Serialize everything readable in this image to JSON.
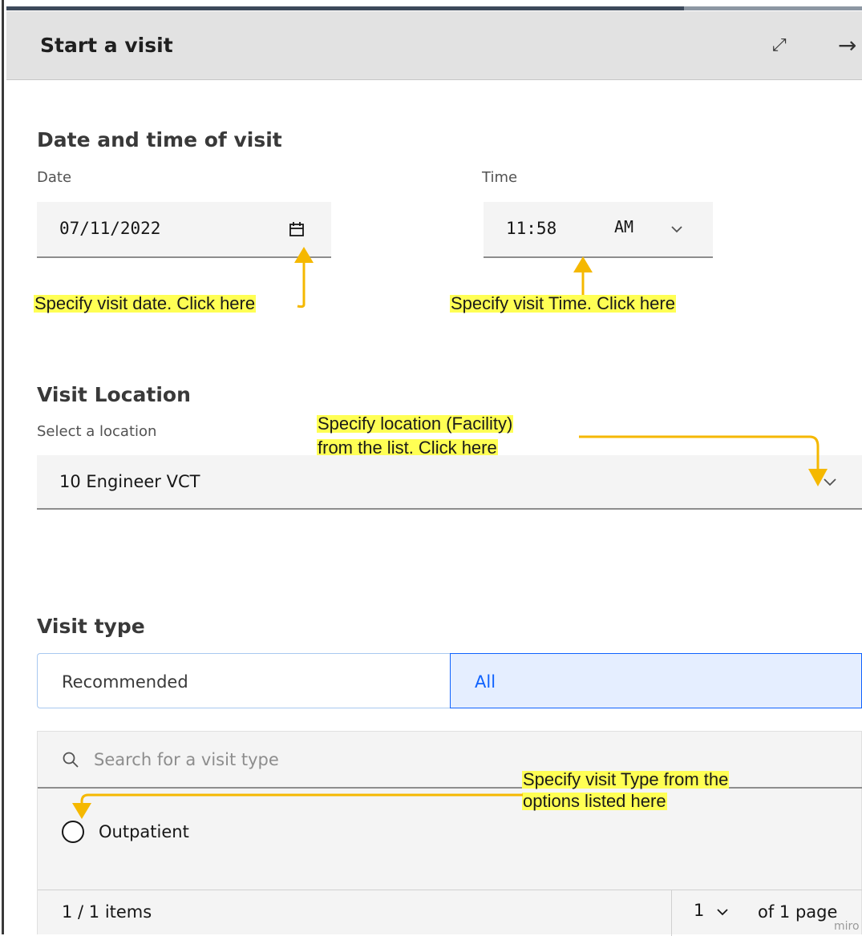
{
  "panel": {
    "title": "Start a visit",
    "expand_icon": "maximize-icon",
    "close_icon": "arrow-right-icon"
  },
  "date_time": {
    "section_title": "Date and time of visit",
    "date_label": "Date",
    "date_value": "07/11/2022",
    "time_label": "Time",
    "time_value": "11:58",
    "ampm_value": "AM"
  },
  "location": {
    "section_title": "Visit Location",
    "label": "Select a location",
    "value": "10 Engineer VCT"
  },
  "visit_type": {
    "section_title": "Visit type",
    "tabs": [
      "Recommended",
      "All"
    ],
    "active_tab": "All",
    "search_placeholder": "Search for a visit type",
    "options": [
      {
        "label": "Outpatient",
        "selected": false
      }
    ],
    "pagination": {
      "items_text": "1 / 1 items",
      "page": "1",
      "of_pages": "of 1 page"
    }
  },
  "annotations": {
    "date_note": "Specify visit date. Click here",
    "time_note": "Specify visit Time. Click here",
    "location_note_line1": "Specify location (Facility)",
    "location_note_line2": "from the list. Click here",
    "type_note_line1": "Specify visit Type from the",
    "type_note_line2": "options listed here",
    "arrow_color": "#f5b800"
  },
  "watermark": "miro",
  "colors": {
    "accent": "#0f62fe",
    "highlight": "#ffff54"
  }
}
